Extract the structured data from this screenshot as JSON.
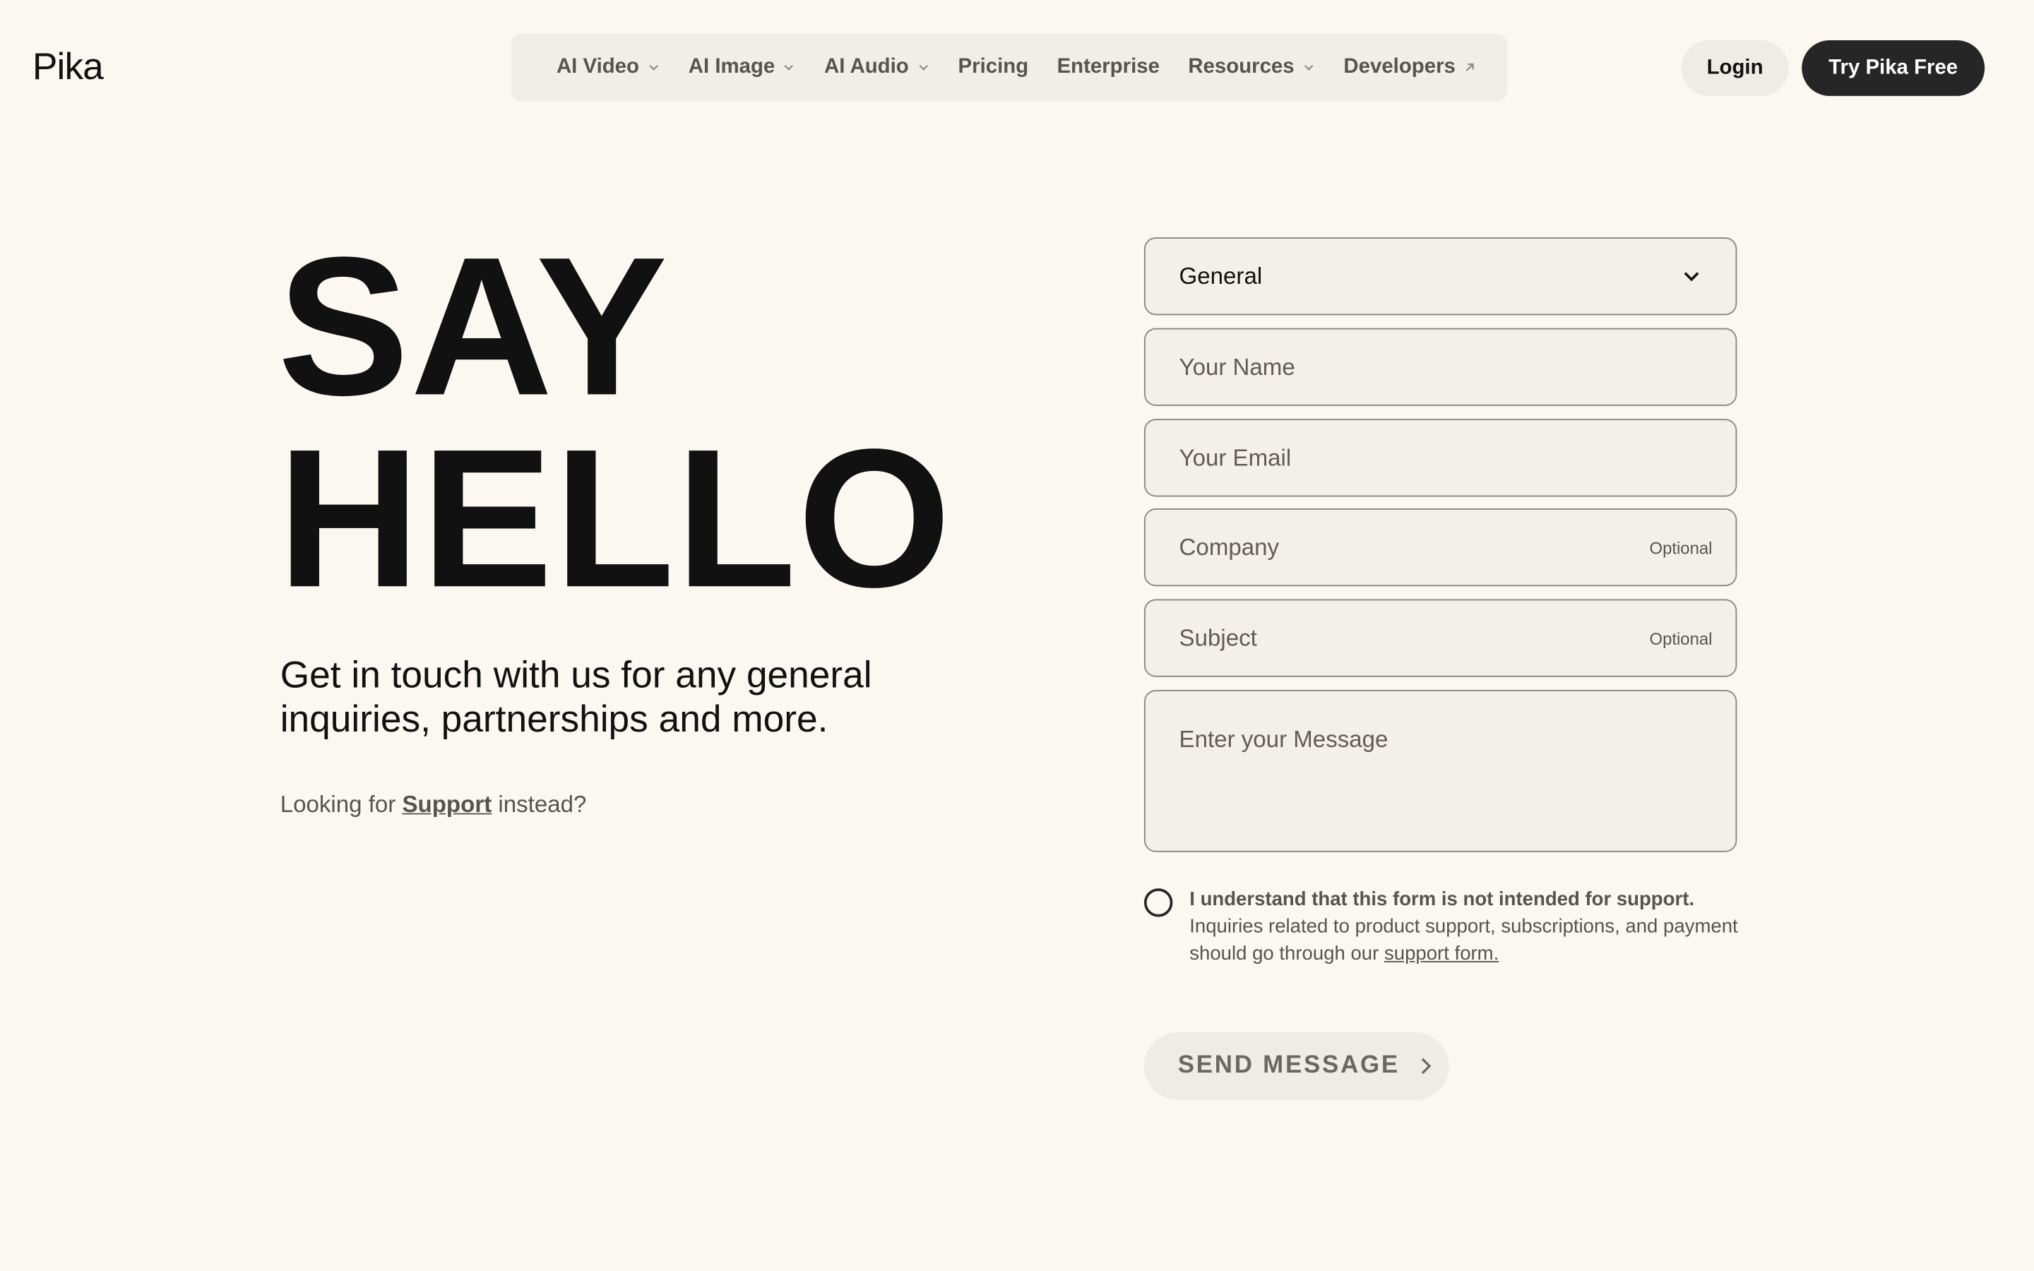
{
  "header": {
    "logo": "Pika",
    "nav": [
      {
        "label": "AI Video",
        "icon": "chevron-down-icon"
      },
      {
        "label": "AI Image",
        "icon": "chevron-down-icon"
      },
      {
        "label": "AI Audio",
        "icon": "chevron-down-icon"
      },
      {
        "label": "Pricing"
      },
      {
        "label": "Enterprise"
      },
      {
        "label": "Resources",
        "icon": "chevron-down-icon"
      },
      {
        "label": "Developers",
        "icon": "external-link-icon"
      }
    ],
    "login_label": "Login",
    "cta_label": "Try Pika Free"
  },
  "hero": {
    "title_line1": "SAY",
    "title_line2": "HELLO",
    "subtitle": "Get in touch with us for any general inquiries, partnerships and more.",
    "support_prefix": "Looking for ",
    "support_link": "Support",
    "support_suffix": " instead?"
  },
  "form": {
    "topic_value": "General",
    "name_placeholder": "Your Name",
    "email_placeholder": "Your Email",
    "company_placeholder": "Company",
    "company_optional": "Optional",
    "subject_placeholder": "Subject",
    "subject_optional": "Optional",
    "message_placeholder": "Enter your Message",
    "consent_title": "I understand that this form is not intended for support.",
    "consent_body": "Inquiries related to product support, subscriptions, and payment should go through our ",
    "consent_link": "support form.",
    "send_label": "SEND MESSAGE"
  },
  "colors": {
    "background": "#FBF7F1",
    "field_bg": "#F3EFEA",
    "field_border": "#8A8580",
    "primary_button": "#262626",
    "secondary_button": "#EFEBE6",
    "text_primary": "#111111",
    "text_muted": "#57534E"
  }
}
